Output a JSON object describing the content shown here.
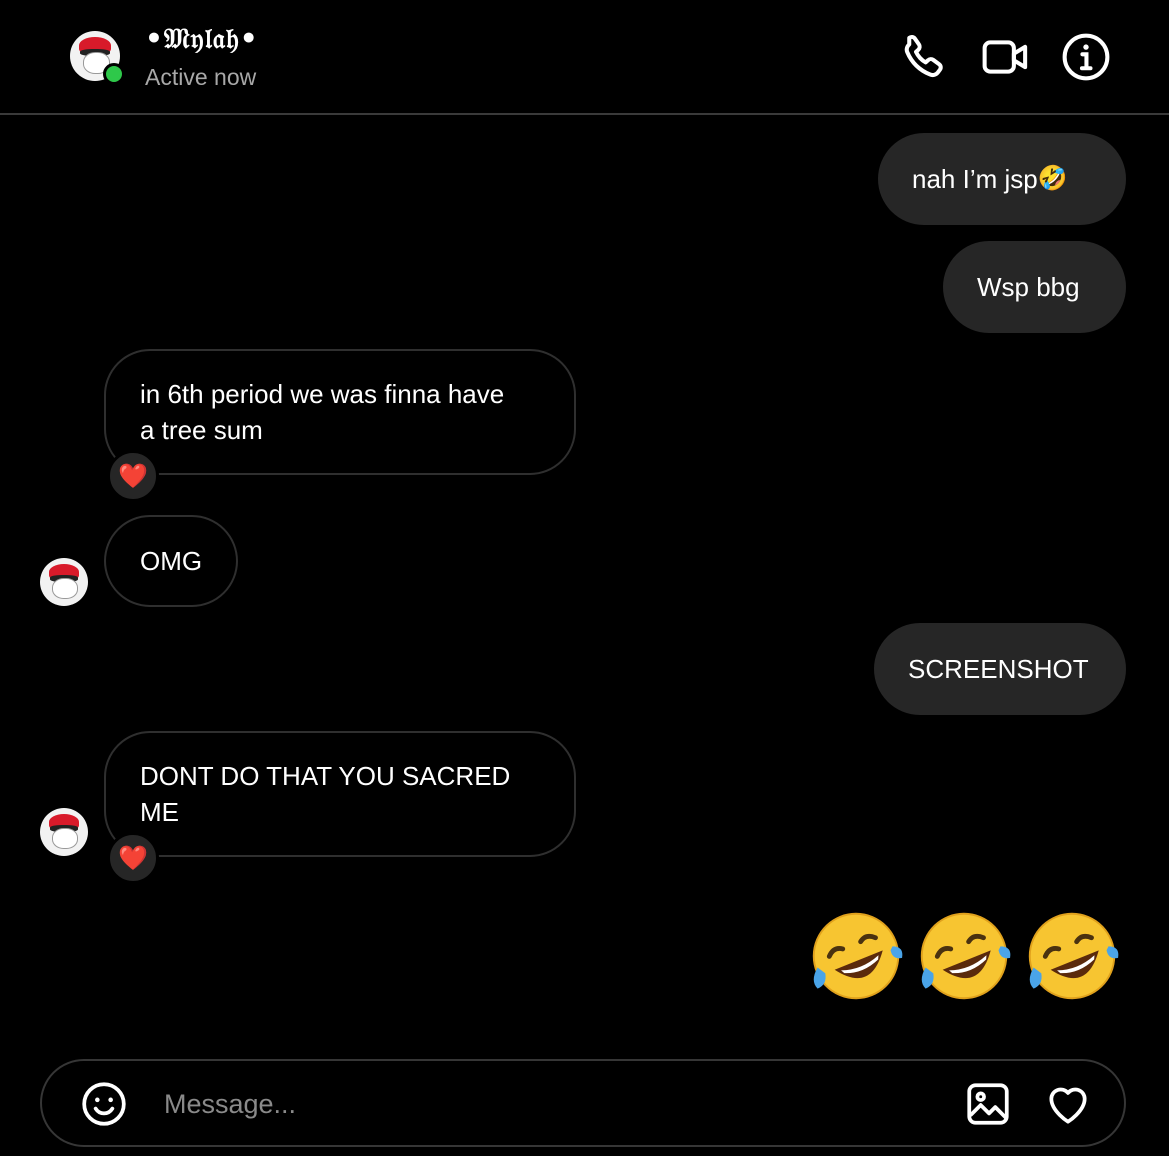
{
  "header": {
    "contact_name": "•𝔐𝔶𝔩𝔞𝔥•",
    "status": "Active now",
    "icons": [
      "phone-icon",
      "video-call-icon",
      "info-icon"
    ]
  },
  "messages": [
    {
      "direction": "outgoing",
      "text": "nah I’m jsp",
      "emoji": "🤣"
    },
    {
      "direction": "outgoing",
      "text": "Wsp bbg"
    },
    {
      "direction": "incoming",
      "text": "in 6th period we was finna have a tree sum",
      "reaction": "❤️"
    },
    {
      "direction": "incoming",
      "text": "OMG"
    },
    {
      "direction": "outgoing",
      "text": "SCREENSHOT"
    },
    {
      "direction": "incoming",
      "text": "DONT DO THAT YOU SACRED ME",
      "reaction": "❤️"
    },
    {
      "direction": "outgoing",
      "emoji_only": [
        "🤣",
        "🤣",
        "🤣"
      ]
    }
  ],
  "composer": {
    "placeholder": "Message...",
    "icons": [
      "emoji-icon",
      "image-icon",
      "heart-icon"
    ]
  },
  "colors": {
    "background": "#000000",
    "outgoing_bubble": "#262626",
    "incoming_border": "#2f2f2f",
    "online": "#2ec84a",
    "reaction_heart": "#e8202e"
  }
}
